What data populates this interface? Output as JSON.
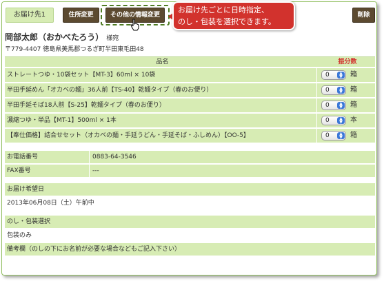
{
  "header": {
    "tab_label": "お届け先1",
    "address_change_label": "住所変更",
    "other_info_change_label": "その他の情報変更",
    "delete_label": "削除"
  },
  "callout": {
    "line1": "お届け先ごとに日時指定、",
    "line2": "のし・包装を選択できます。"
  },
  "recipient": {
    "name": "岡部太郎（おかべたろう）",
    "honorific": "様宛",
    "address": "〒779-4407 徳島県美馬郡つるぎ町半田東毛田48"
  },
  "products": {
    "col_name": "品名",
    "col_qty": "振分数",
    "rows": [
      {
        "name": "ストレートつゆ・10袋セット【MT-3】60ml × 10袋",
        "qty": "0",
        "unit": "箱"
      },
      {
        "name": "半田手延めん「オカベの麺」36人前【TS-40】乾麺タイプ（春のお便り）",
        "qty": "0",
        "unit": "箱"
      },
      {
        "name": "半田手延そば18人前【S-25】乾麺タイプ（春のお便り）",
        "qty": "0",
        "unit": "箱"
      },
      {
        "name": "濃縮つゆ・単品【MT-1】500ml × 1本",
        "qty": "0",
        "unit": "本"
      },
      {
        "name": "【奉仕価格】詰合せセット（オカベの麺・手延うどん・手延そば・ふしめん）【OO-5】",
        "qty": "0",
        "unit": "箱"
      }
    ]
  },
  "contact": {
    "phone_label": "お電話番号",
    "phone_value": "0883-64-3546",
    "fax_label": "FAX番号",
    "fax_value": "---"
  },
  "delivery": {
    "label": "お届け希望日",
    "value": "2013年06月08日（土）午前中"
  },
  "wrapping": {
    "label": "のし・包装選択",
    "value": "包装のみ",
    "remarks_label": "備考欄（のしの下にお名前が必要な場合などもご記入下さい）"
  },
  "colors": {
    "accent_green": "#d7ecb4",
    "button_brown": "#5c4a30",
    "callout_red": "#d2322d",
    "qty_header_red": "#d2322d"
  }
}
